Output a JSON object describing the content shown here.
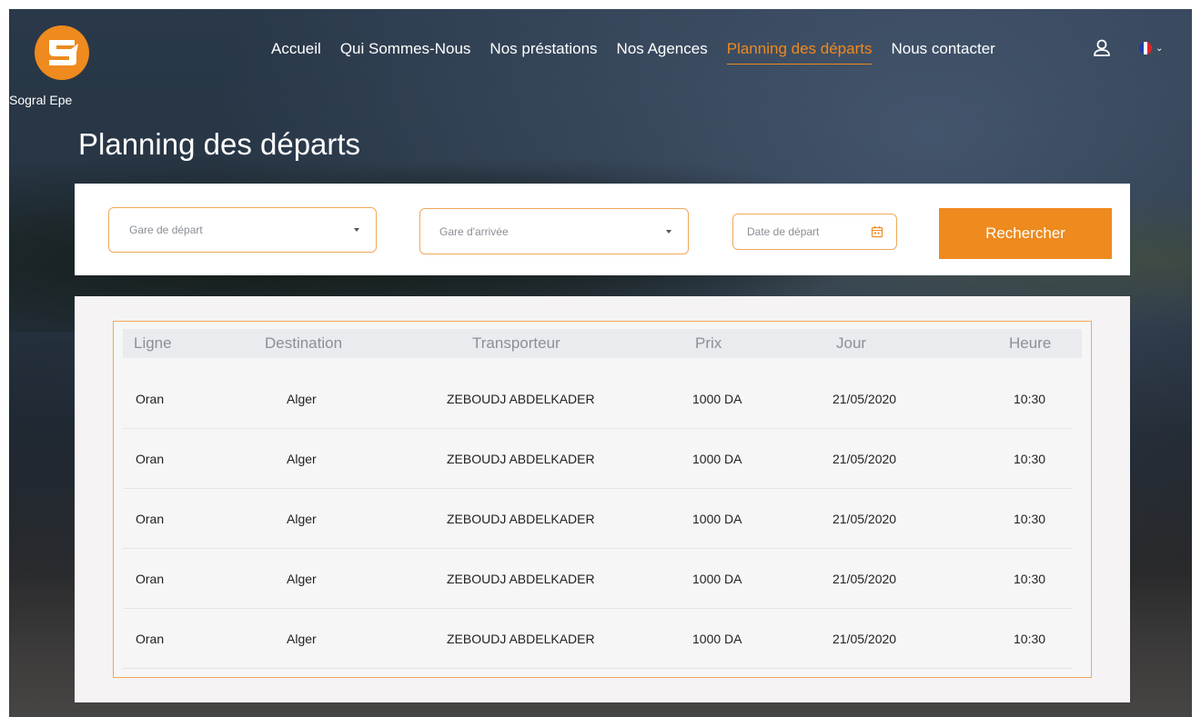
{
  "brand": {
    "name": "Sogral Epe"
  },
  "nav": {
    "items": [
      {
        "label": "Accueil",
        "active": false
      },
      {
        "label": "Qui Sommes-Nous",
        "active": false
      },
      {
        "label": "Nos préstations",
        "active": false
      },
      {
        "label": "Nos Agences",
        "active": false
      },
      {
        "label": "Planning des départs",
        "active": true
      },
      {
        "label": "Nous contacter",
        "active": false
      }
    ],
    "user_icon": "user-icon",
    "language": {
      "icon": "flag-fr-icon",
      "colors": [
        "#1f3fa8",
        "#ffffff",
        "#e0242b"
      ]
    }
  },
  "page": {
    "title": "Planning des départs"
  },
  "search": {
    "depart_placeholder": "Gare de départ",
    "arrivee_placeholder": "Gare d'arrivée",
    "date_placeholder": "Date de départ",
    "button_label": "Rechercher"
  },
  "table": {
    "columns": [
      "Ligne",
      "Destination",
      "Transporteur",
      "Prix",
      "Jour",
      "Heure"
    ],
    "rows": [
      [
        "Oran",
        "Alger",
        "ZEBOUDJ ABDELKADER",
        "1000 DA",
        "21/05/2020",
        "10:30"
      ],
      [
        "Oran",
        "Alger",
        "ZEBOUDJ ABDELKADER",
        "1000 DA",
        "21/05/2020",
        "10:30"
      ],
      [
        "Oran",
        "Alger",
        "ZEBOUDJ ABDELKADER",
        "1000 DA",
        "21/05/2020",
        "10:30"
      ],
      [
        "Oran",
        "Alger",
        "ZEBOUDJ ABDELKADER",
        "1000 DA",
        "21/05/2020",
        "10:30"
      ],
      [
        "Oran",
        "Alger",
        "ZEBOUDJ ABDELKADER",
        "1000 DA",
        "21/05/2020",
        "10:30"
      ]
    ]
  },
  "colors": {
    "accent": "#ee8a1e",
    "field_border": "#f0a85b"
  }
}
